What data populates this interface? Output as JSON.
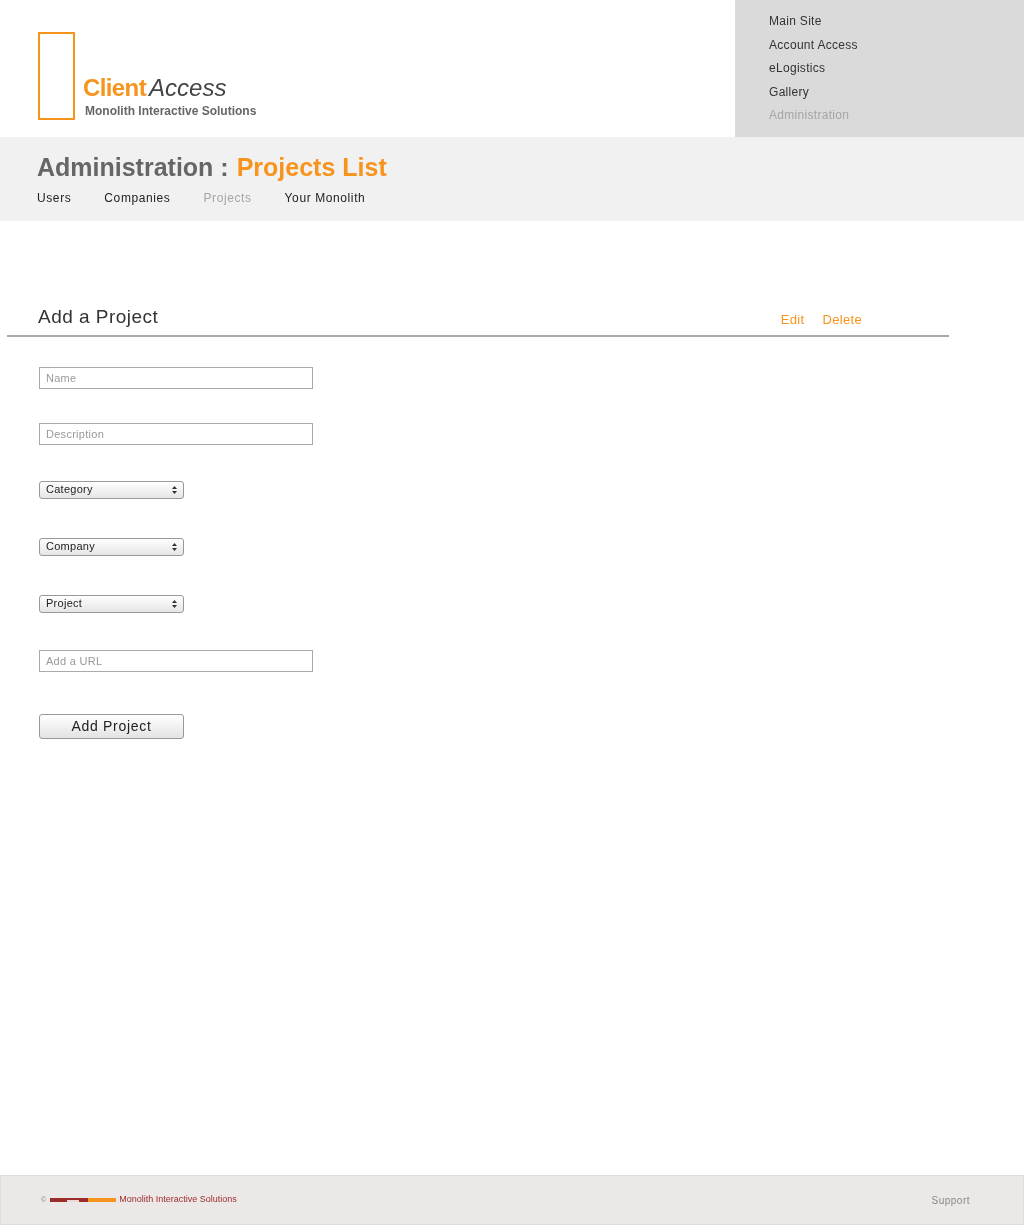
{
  "logo": {
    "brand": "Client",
    "product": "Access",
    "company": "Monolith Interactive Solutions"
  },
  "site_nav": [
    {
      "label": "Main Site",
      "selected": false
    },
    {
      "label": "Account Access",
      "selected": false
    },
    {
      "label": "eLogistics",
      "selected": false
    },
    {
      "label": "Gallery",
      "selected": false
    },
    {
      "label": "Administration",
      "selected": true
    }
  ],
  "page_title": {
    "section": "Administration :",
    "page": "Projects List"
  },
  "sub_nav": [
    {
      "label": "Users",
      "selected": false
    },
    {
      "label": "Companies",
      "selected": false
    },
    {
      "label": "Projects",
      "selected": true
    },
    {
      "label": "Your Monolith",
      "selected": false
    }
  ],
  "form": {
    "title": "Add a Project",
    "actions": [
      "Edit",
      "Delete"
    ],
    "fields": [
      {
        "kind": "input",
        "placeholder": "Name"
      },
      {
        "kind": "input",
        "placeholder": "Description"
      },
      {
        "kind": "select",
        "value": "Category"
      },
      {
        "kind": "select",
        "value": "Company"
      },
      {
        "kind": "select",
        "value": "Project"
      },
      {
        "kind": "input",
        "placeholder": "Add a URL"
      }
    ],
    "submit": "Add Project"
  },
  "footer": {
    "copyright": "©",
    "company": "Monolith Interactive Solutions",
    "link": "Support"
  }
}
